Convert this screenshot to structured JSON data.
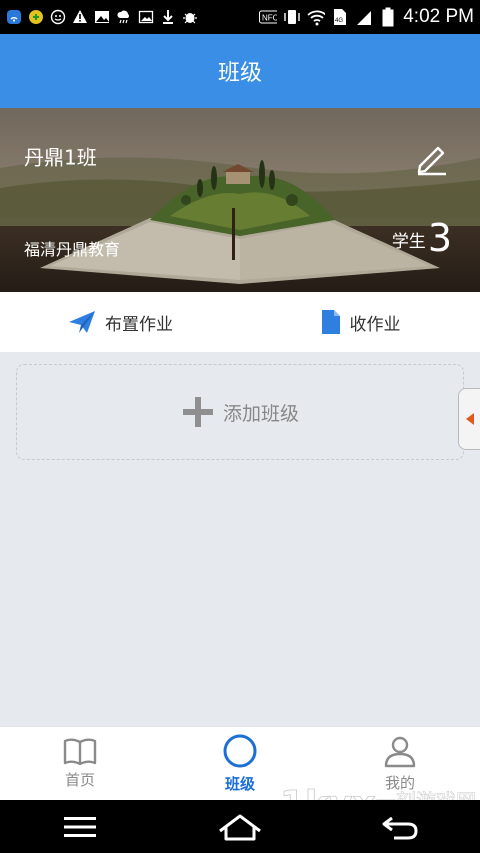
{
  "status_bar": {
    "time": "4:02 PM",
    "left_icons": [
      "wifi-calling-icon",
      "app-badge-icon",
      "face-icon",
      "warning-icon",
      "image-icon",
      "cloud-icon",
      "picture-icon",
      "download-icon",
      "bug-icon"
    ],
    "right_icons": [
      "nfc-icon",
      "vibrate-icon",
      "wifi-icon",
      "sim-icon",
      "signal-icon",
      "battery-icon"
    ]
  },
  "app_bar": {
    "title": "班级"
  },
  "class_card": {
    "name": "丹鼎1班",
    "school": "福清丹鼎教育",
    "student_label": "学生",
    "student_count": "3"
  },
  "actions": {
    "assign": "布置作业",
    "collect": "收作业"
  },
  "add_class": {
    "label": "添加班级"
  },
  "bottom_nav": {
    "home": "首页",
    "classes": "班级",
    "mine": "我的",
    "active": "classes"
  },
  "watermark": {
    "brand": "1kyx",
    "text": "一刻游戏网",
    "url": "www.1kyx.com"
  },
  "colors": {
    "primary": "#3a8ee6",
    "active_nav": "#1d6fd8",
    "background": "#e6e9ee"
  }
}
